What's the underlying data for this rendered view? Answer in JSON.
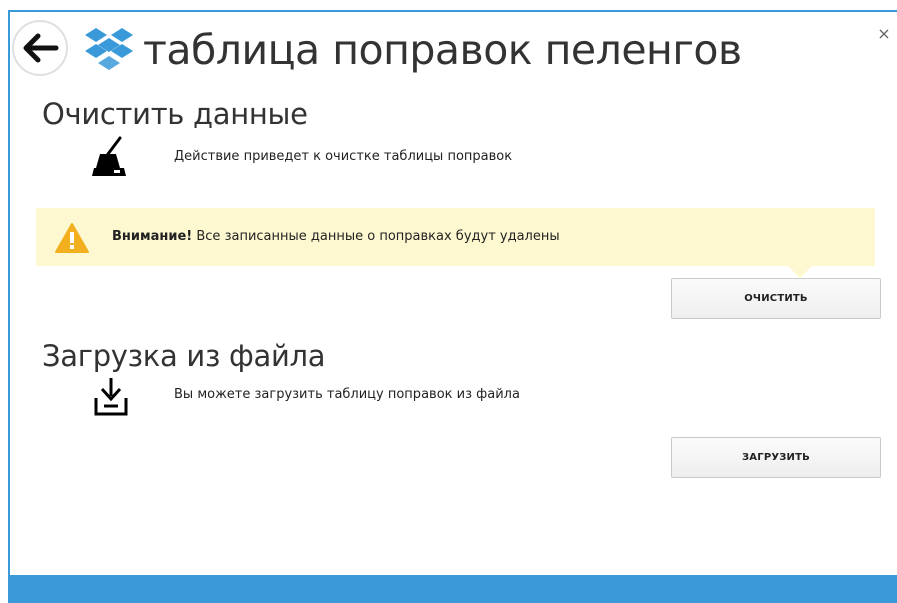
{
  "header": {
    "title": "таблица поправок пеленгов",
    "close_label": "×"
  },
  "clear_section": {
    "title": "Очистить данные",
    "icon": "broom-icon",
    "description": "Действие приведет к очистке таблицы поправок",
    "warning_bold": "Внимание!",
    "warning_text": " Все записанные данные о поправках будут удалены",
    "button_label": "ОЧИСТИТЬ"
  },
  "load_section": {
    "title": "Загрузка из файла",
    "icon": "download-tray-icon",
    "description": "Вы можете загрузить таблицу поправок из файла",
    "button_label": "ЗАГРУЗИТЬ"
  },
  "colors": {
    "accent": "#3a9ad9",
    "warning_bg": "#fdf8d0",
    "warning_icon": "#f2b01e"
  }
}
